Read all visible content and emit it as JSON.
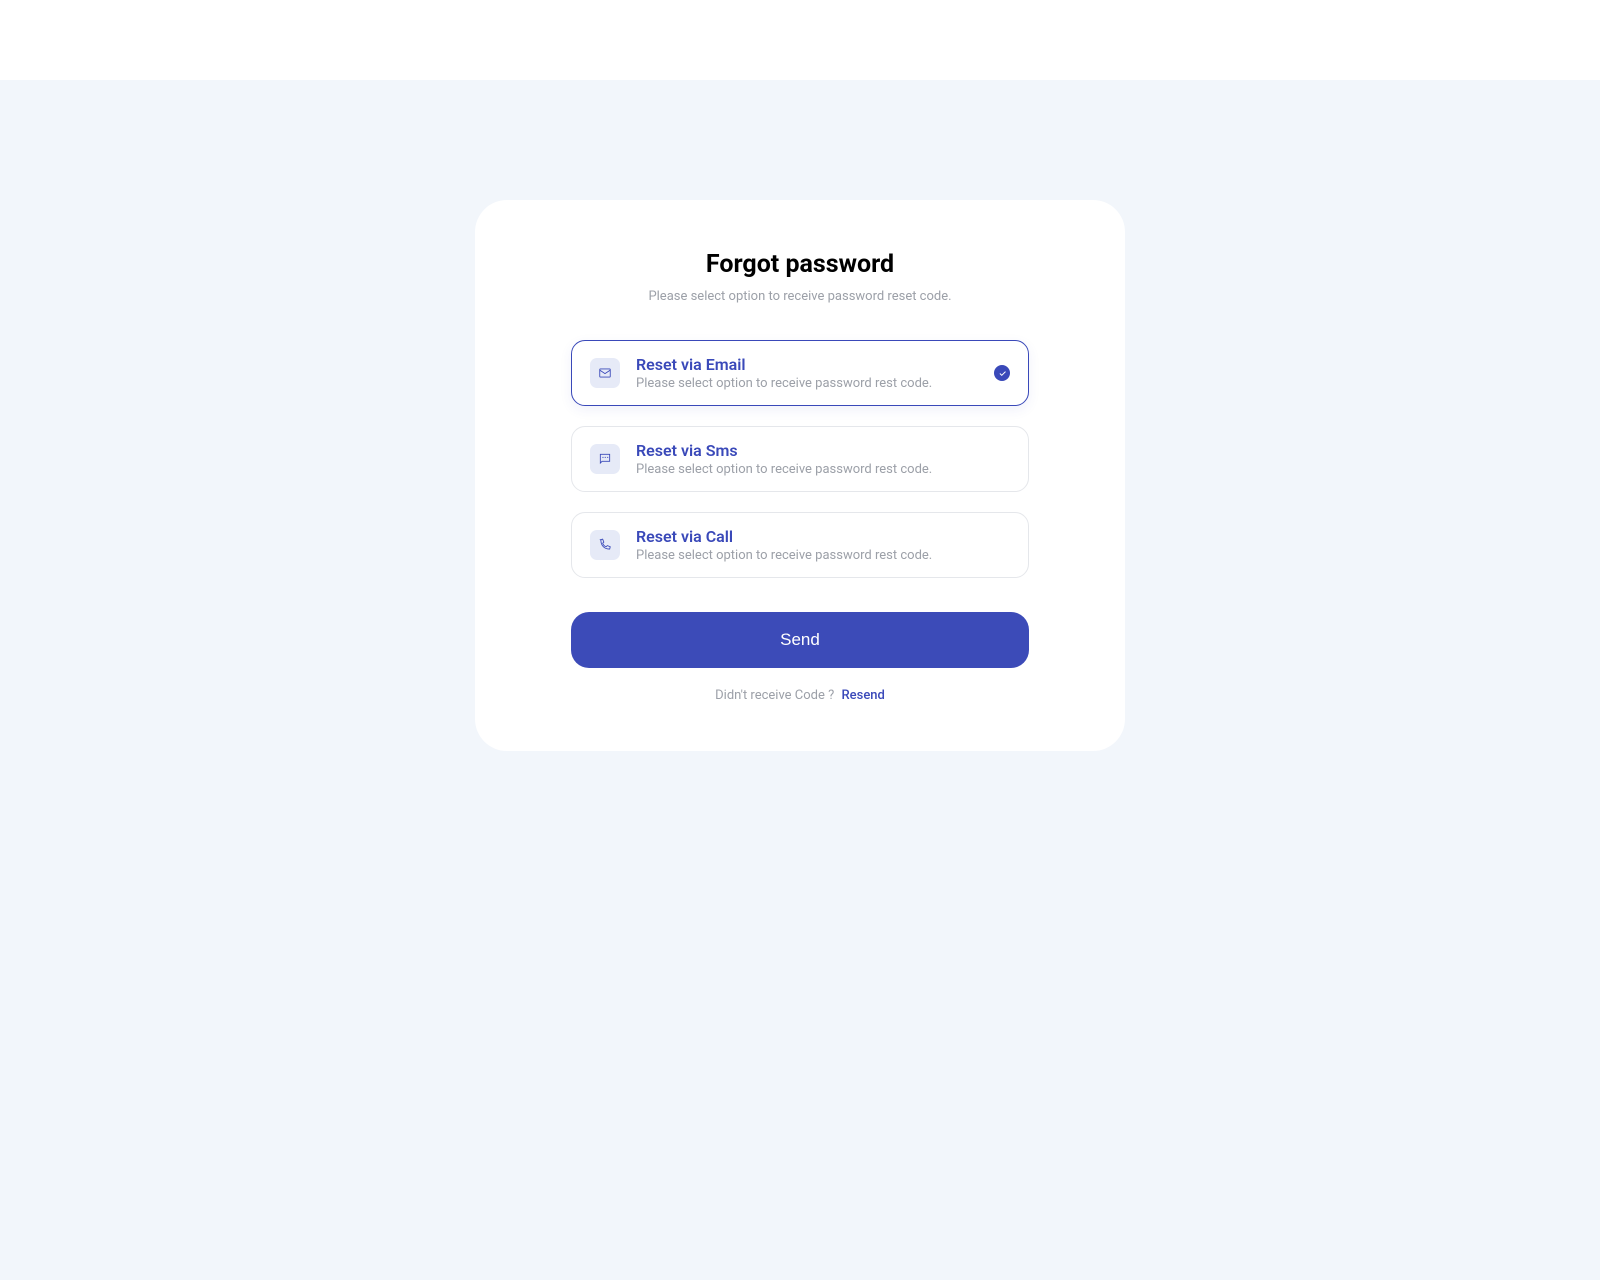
{
  "title": "Forgot password",
  "subtitle": "Please select option to receive password reset code.",
  "options": [
    {
      "title": "Reset via Email",
      "desc": "Please select option to receive password rest code.",
      "selected": true
    },
    {
      "title": "Reset via Sms",
      "desc": "Please select option to receive password rest code.",
      "selected": false
    },
    {
      "title": "Reset via Call",
      "desc": "Please select option to receive password rest code.",
      "selected": false
    }
  ],
  "send_label": "Send",
  "footer_prompt": "Didn't receive Code ?",
  "resend_label": "Resend"
}
